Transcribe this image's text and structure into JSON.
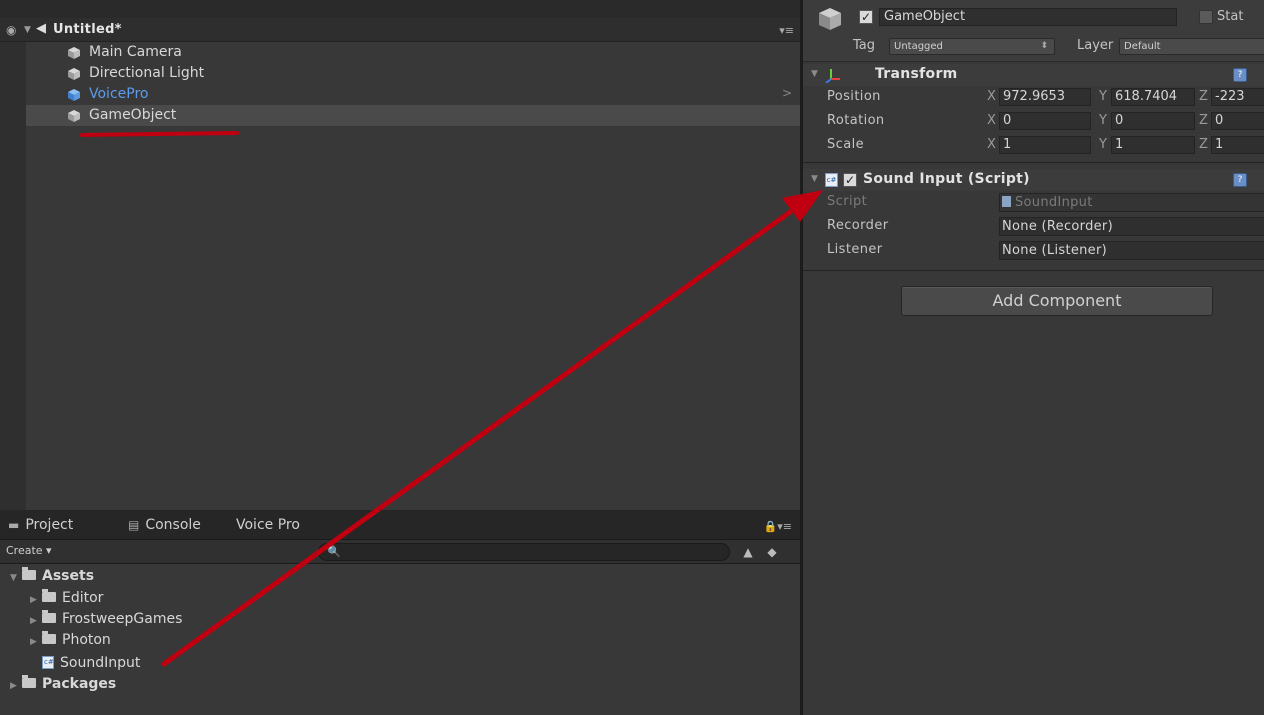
{
  "hierarchy": {
    "scene_name": "Untitled*",
    "items": [
      {
        "label": "Main Camera",
        "kind": "normal"
      },
      {
        "label": "Directional Light",
        "kind": "normal"
      },
      {
        "label": "VoicePro",
        "kind": "prefab"
      },
      {
        "label": "GameObject",
        "kind": "selected"
      }
    ]
  },
  "project": {
    "tabs": [
      {
        "label": "Project"
      },
      {
        "label": "Console"
      },
      {
        "label": "Voice Pro"
      }
    ],
    "create_label": "Create",
    "tree": [
      {
        "label": "Assets"
      },
      {
        "label": "Editor"
      },
      {
        "label": "FrostweepGames"
      },
      {
        "label": "Photon"
      },
      {
        "label": "SoundInput"
      },
      {
        "label": "Packages"
      }
    ]
  },
  "inspector": {
    "object_name": "GameObject",
    "static_label": "Stat",
    "tag_label": "Tag",
    "tag_value": "Untagged",
    "layer_label": "Layer",
    "layer_value": "Default",
    "transform": {
      "title": "Transform",
      "position": {
        "label": "Position",
        "x": "972.9653",
        "y": "618.7404",
        "z": "-223"
      },
      "rotation": {
        "label": "Rotation",
        "x": "0",
        "y": "0",
        "z": "0"
      },
      "scale": {
        "label": "Scale",
        "x": "1",
        "y": "1",
        "z": "1"
      }
    },
    "component": {
      "title": "Sound Input (Script)",
      "script_label": "Script",
      "script_value": "SoundInput",
      "recorder_label": "Recorder",
      "recorder_value": "None (Recorder)",
      "listener_label": "Listener",
      "listener_value": "None (Listener)"
    },
    "add_component_label": "Add Component"
  },
  "axes": {
    "x": "X",
    "y": "Y",
    "z": "Z"
  },
  "colors": {
    "panel_bg": "#383838",
    "prefab_text": "#5d9bec",
    "annotation_red": "#c00010"
  }
}
